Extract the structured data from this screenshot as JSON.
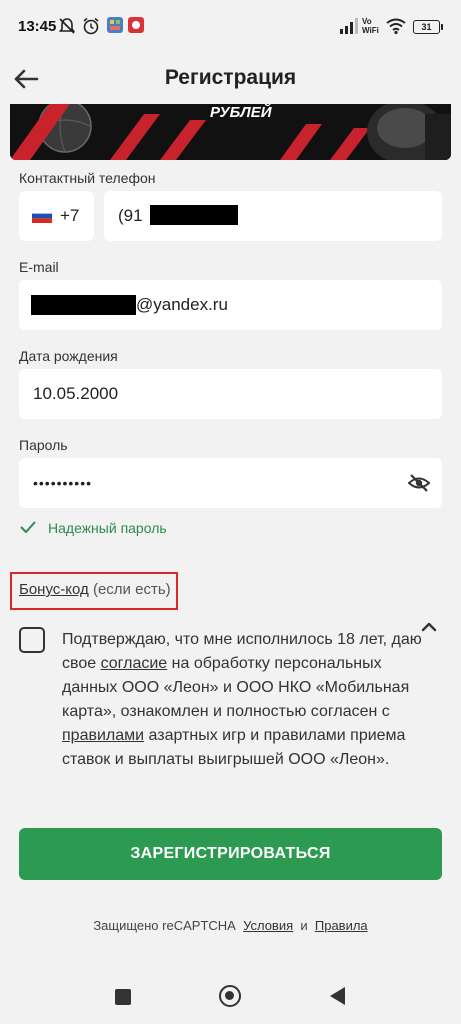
{
  "status_bar": {
    "time": "13:45",
    "network": "Vo WiFi",
    "battery": "31"
  },
  "header": {
    "title": "Регистрация",
    "back_icon": "arrow-left-icon"
  },
  "banner": {
    "text": "РУБЛЕЙ"
  },
  "form": {
    "phone": {
      "label": "Контактный телефон",
      "country_code": "+7",
      "value_visible": "(91"
    },
    "email": {
      "label": "E-mail",
      "value_visible": "@yandex.ru"
    },
    "birthdate": {
      "label": "Дата рождения",
      "value": "10.05.2000"
    },
    "password": {
      "label": "Пароль",
      "value": "••••••••••",
      "toggle_icon": "eye-off-icon"
    },
    "password_strength": "Надежный пароль",
    "bonus": {
      "link": "Бонус-код",
      "hint": "(если есть)"
    }
  },
  "consent": {
    "part1": "Подтверждаю, что мне исполнилось 18 лет, даю свое ",
    "link1": "согласие",
    "part2": " на обработку персональных данных ООО «Леон» и ООО НКО «Мобильная карта», ознакомлен и полностью согласен с ",
    "link2": "правилами",
    "part3": " азартных игр и правилами приема ставок и выплаты выигрышей ООО «Леон»."
  },
  "register_button": "ЗАРЕГИСТРИРОВАТЬСЯ",
  "footer": {
    "protected": "Защищено reCAPTCHA",
    "terms": "Условия",
    "and": "и",
    "privacy": "Правила"
  },
  "colors": {
    "accent": "#2d9a52",
    "highlight": "#d62a2a",
    "background": "#f2f2f2"
  }
}
